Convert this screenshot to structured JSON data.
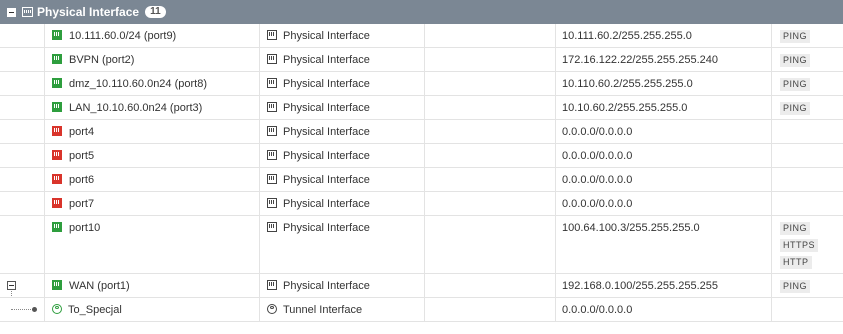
{
  "group": {
    "title": "Physical Interface",
    "count": "11"
  },
  "rows": [
    {
      "name": "10.111.60.0/24 (port9)",
      "status": "up",
      "type": "Physical Interface",
      "ip": "10.111.60.2/255.255.255.0",
      "access": [
        "PING"
      ]
    },
    {
      "name": "BVPN (port2)",
      "status": "up",
      "type": "Physical Interface",
      "ip": "172.16.122.22/255.255.255.240",
      "access": [
        "PING"
      ]
    },
    {
      "name": "dmz_10.110.60.0n24 (port8)",
      "status": "up",
      "type": "Physical Interface",
      "ip": "10.110.60.2/255.255.255.0",
      "access": [
        "PING"
      ]
    },
    {
      "name": "LAN_10.10.60.0n24 (port3)",
      "status": "up",
      "type": "Physical Interface",
      "ip": "10.10.60.2/255.255.255.0",
      "access": [
        "PING"
      ]
    },
    {
      "name": "port4",
      "status": "down",
      "type": "Physical Interface",
      "ip": "0.0.0.0/0.0.0.0",
      "access": []
    },
    {
      "name": "port5",
      "status": "down",
      "type": "Physical Interface",
      "ip": "0.0.0.0/0.0.0.0",
      "access": []
    },
    {
      "name": "port6",
      "status": "down",
      "type": "Physical Interface",
      "ip": "0.0.0.0/0.0.0.0",
      "access": []
    },
    {
      "name": "port7",
      "status": "down",
      "type": "Physical Interface",
      "ip": "0.0.0.0/0.0.0.0",
      "access": []
    },
    {
      "name": "port10",
      "status": "up",
      "type": "Physical Interface",
      "ip": "100.64.100.3/255.255.255.0",
      "access": [
        "PING",
        "HTTPS",
        "HTTP"
      ]
    },
    {
      "name": "WAN (port1)",
      "status": "up",
      "type": "Physical Interface",
      "ip": "192.168.0.100/255.255.255.255",
      "access": [
        "PING"
      ],
      "expandable": true
    },
    {
      "name": "To_Specjal",
      "status": "tunnel",
      "type": "Tunnel Interface",
      "ip": "0.0.0.0/0.0.0.0",
      "access": [],
      "child": true
    }
  ]
}
